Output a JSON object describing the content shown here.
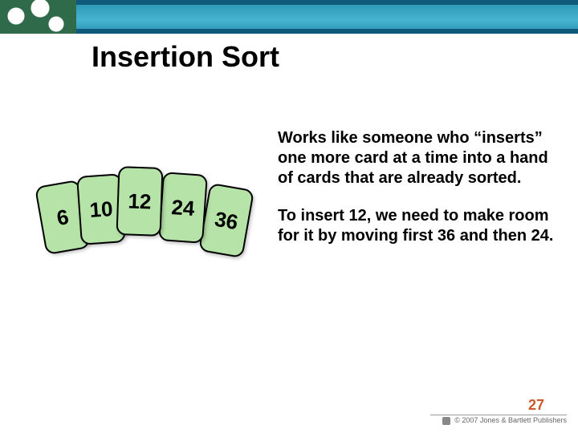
{
  "title": "Insertion Sort",
  "cards": [
    "6",
    "10",
    "12",
    "24",
    "36"
  ],
  "desc": {
    "p1": "Works like someone who “inserts” one more card at a time into a hand of cards that are already sorted.",
    "p2": "To insert 12, we need to make room for it by moving first 36 and then 24."
  },
  "slide_number": "27",
  "publisher": "© 2007 Jones & Bartlett Publishers"
}
